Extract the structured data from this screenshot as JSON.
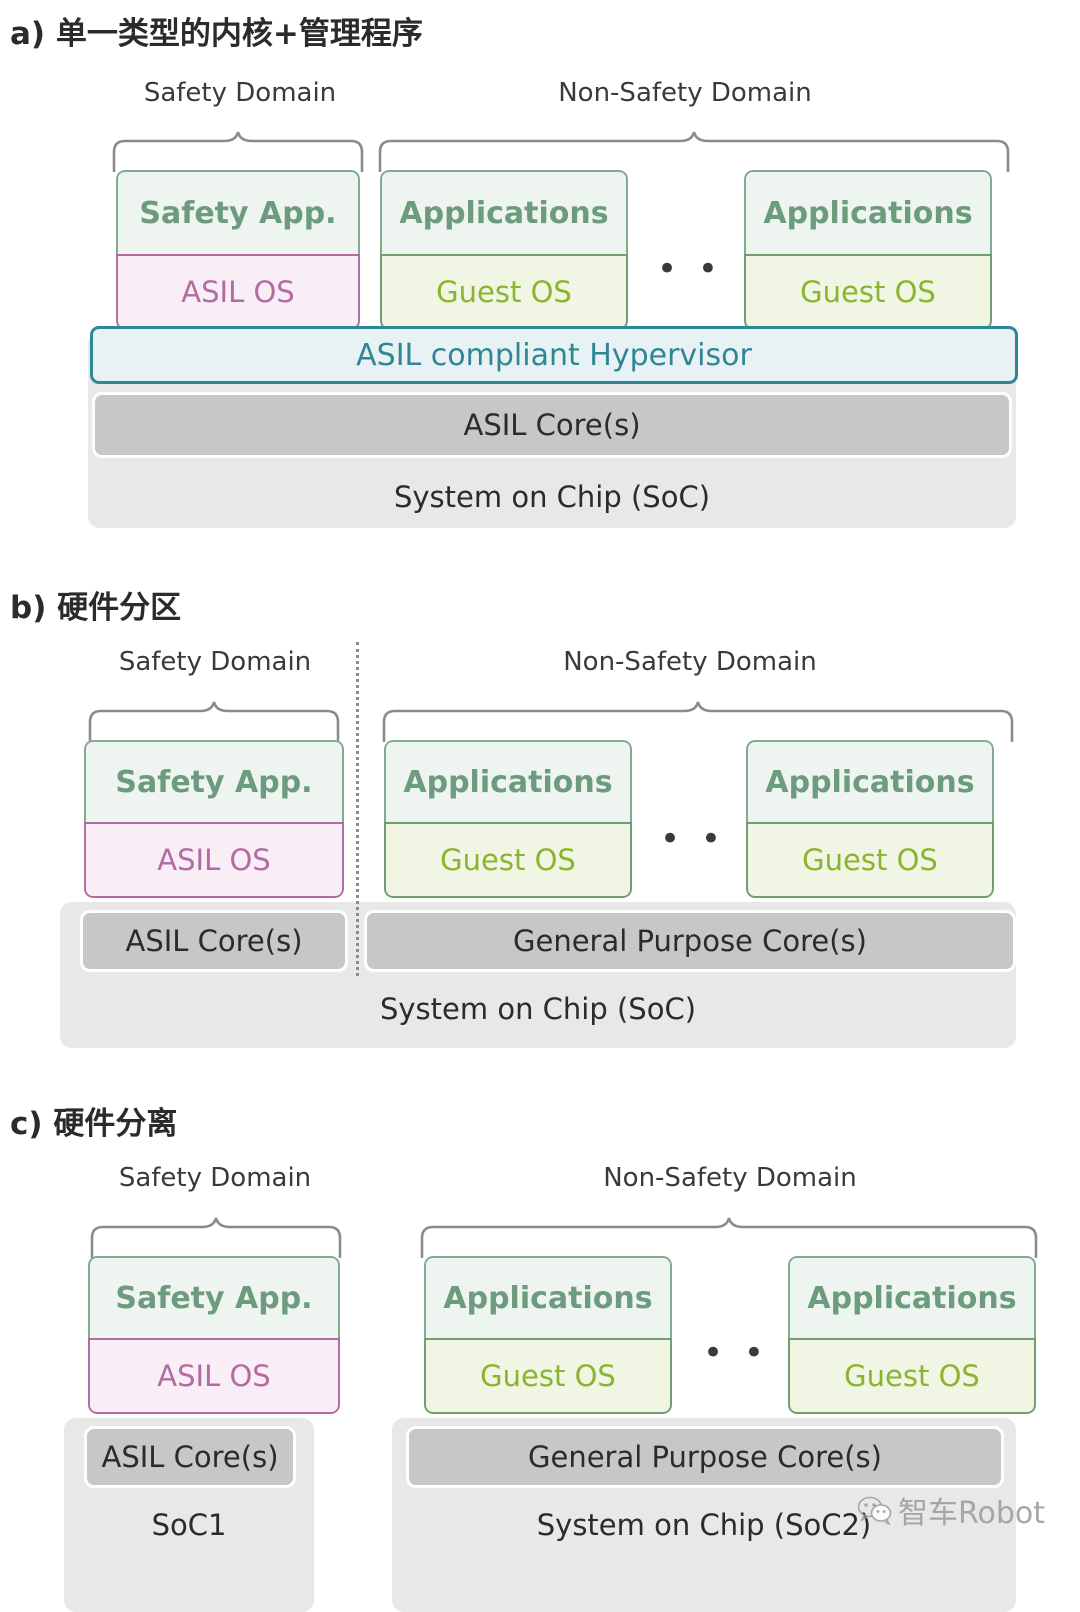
{
  "sections": [
    {
      "id": "a",
      "title": "a) 单一类型的内核+管理程序",
      "safety_domain_label": "Safety Domain",
      "nonsafety_domain_label": "Non-Safety Domain",
      "safety_app_label": "Safety App.",
      "asil_os_label": "ASIL OS",
      "applications_label": "Applications",
      "guest_os_label": "Guest OS",
      "ellipsis": "• • •",
      "hypervisor_label": "ASIL compliant Hypervisor",
      "asil_core_label": "ASIL Core(s)",
      "soc_label": "System on Chip (SoC)"
    },
    {
      "id": "b",
      "title": "b) 硬件分区",
      "safety_domain_label": "Safety Domain",
      "nonsafety_domain_label": "Non-Safety Domain",
      "safety_app_label": "Safety App.",
      "asil_os_label": "ASIL OS",
      "applications_label": "Applications",
      "guest_os_label": "Guest OS",
      "ellipsis": "• • •",
      "asil_core_label": "ASIL Core(s)",
      "gp_core_label": "General Purpose Core(s)",
      "soc_label": "System on Chip (SoC)"
    },
    {
      "id": "c",
      "title": "c) 硬件分离",
      "safety_domain_label": "Safety Domain",
      "nonsafety_domain_label": "Non-Safety Domain",
      "safety_app_label": "Safety App.",
      "asil_os_label": "ASIL OS",
      "applications_label": "Applications",
      "guest_os_label": "Guest OS",
      "ellipsis": "• • •",
      "asil_core_label": "ASIL Core(s)",
      "gp_core_label": "General Purpose Core(s)",
      "soc1_label": "SoC1",
      "soc2_label": "System on Chip (SoC2)"
    }
  ],
  "watermark": {
    "text": "智车Robot",
    "icon": "wechat-icon"
  },
  "colors": {
    "app_border": "#7fab8e",
    "app_fill": "#eef4f0",
    "app_text": "#6d9b7d",
    "asil_border": "#b36ba4",
    "asil_fill": "#f9eef5",
    "asil_text": "#b36ba4",
    "guest_border": "#6f9e72",
    "guest_fill": "#f1f5e4",
    "guest_text": "#8ab52e",
    "hypervisor_border": "#2f8795",
    "hypervisor_fill": "#e8f1f4",
    "hypervisor_text": "#2f8795",
    "soc_fill": "#e8e8e8",
    "core_fill": "#c7c7c7",
    "brace": "#8b8b8b",
    "heading": "#2b2b2b"
  }
}
